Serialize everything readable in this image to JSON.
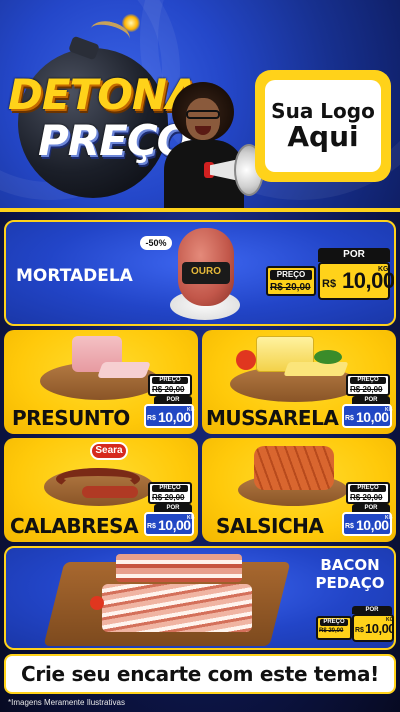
{
  "header": {
    "title_line1": "DETONA",
    "title_line2": "PREÇO",
    "logo_line1": "Sua Logo",
    "logo_line2": "Aqui"
  },
  "products": {
    "mortadela": {
      "name": "MORTADELA",
      "discount_badge": "-50%",
      "brand_label": "OURO",
      "por_label": "POR",
      "preco_label": "PREÇO",
      "old_price": "R$ 20,00",
      "currency": "R$",
      "new_price": "10,00",
      "unit": "KG"
    },
    "presunto": {
      "name": "PRESUNTO",
      "preco_label": "PREÇO",
      "old_price": "R$ 20,00",
      "por_label": "POR",
      "currency": "R$",
      "new_price": "10,00",
      "unit": "KG"
    },
    "mussarela": {
      "name": "MUSSARELA",
      "preco_label": "PREÇO",
      "old_price": "R$ 20,00",
      "por_label": "POR",
      "currency": "R$",
      "new_price": "10,00",
      "unit": "KG"
    },
    "calabresa": {
      "name": "CALABRESA",
      "brand_label": "Seara",
      "preco_label": "PREÇO",
      "old_price": "R$ 20,00",
      "por_label": "POR",
      "currency": "R$",
      "new_price": "10,00",
      "unit": "KG"
    },
    "salsicha": {
      "name": "SALSICHA",
      "preco_label": "PREÇO",
      "old_price": "R$ 20,00",
      "por_label": "POR",
      "currency": "R$",
      "new_price": "10,00",
      "unit": "KG"
    },
    "bacon": {
      "name_line1": "BACON",
      "name_line2": "PEDAÇO",
      "preco_label": "PREÇO",
      "old_price": "R$ 20,00",
      "por_label": "POR",
      "currency": "R$",
      "new_price": "10,00",
      "unit": "KG"
    }
  },
  "footer": {
    "cta": "Crie seu encarte com este tema!",
    "disclaimer": "*Imagens Meramente Ilustrativas"
  },
  "colors": {
    "blue": "#2245c8",
    "yellow": "#ffd21a",
    "dark": "#111111"
  }
}
